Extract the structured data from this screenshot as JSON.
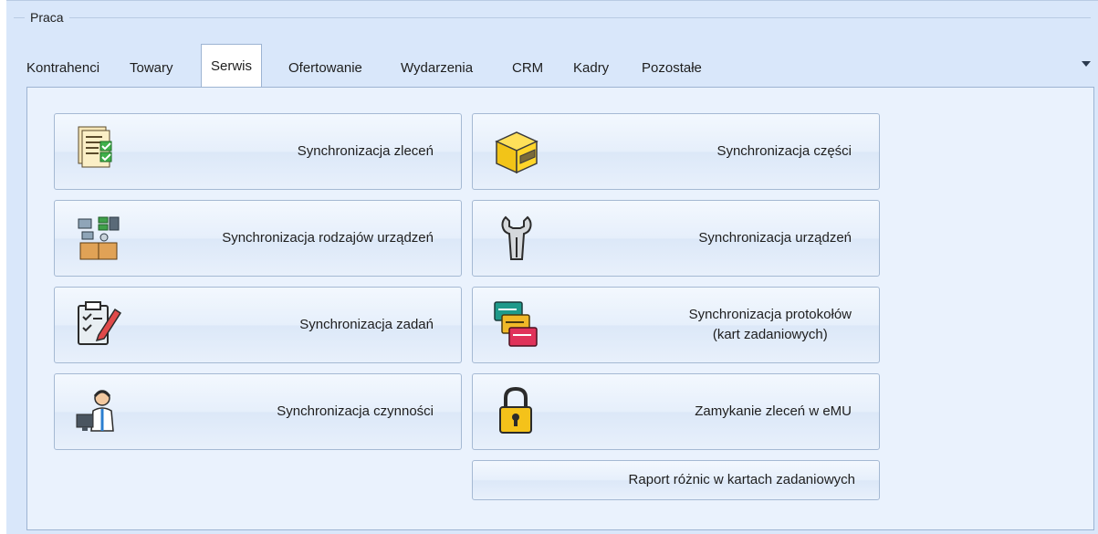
{
  "group": {
    "title": "Praca"
  },
  "tabs": [
    {
      "label": "Kontrahenci",
      "active": false
    },
    {
      "label": "Towary",
      "active": false
    },
    {
      "label": "Serwis",
      "active": true
    },
    {
      "label": "Ofertowanie",
      "active": false
    },
    {
      "label": "Wydarzenia",
      "active": false
    },
    {
      "label": "CRM",
      "active": false
    },
    {
      "label": "Kadry",
      "active": false
    },
    {
      "label": "Pozostałe",
      "active": false
    }
  ],
  "buttons": {
    "sync_orders": {
      "label": "Synchronizacja zleceń",
      "icon": "document-checklist-icon"
    },
    "sync_parts": {
      "label": "Synchronizacja części",
      "icon": "box-icon"
    },
    "sync_device_types": {
      "label": "Synchronizacja rodzajów urządzeń",
      "icon": "devices-box-icon"
    },
    "sync_devices": {
      "label": "Synchronizacja urządzeń",
      "icon": "wrench-icon"
    },
    "sync_tasks": {
      "label": "Synchronizacja zadań",
      "icon": "clipboard-pencil-icon"
    },
    "sync_protocols": {
      "label": "Synchronizacja protokołów\n(kart zadaniowych)",
      "icon": "cards-icon"
    },
    "sync_activities": {
      "label": "Synchronizacja czynności",
      "icon": "technician-icon"
    },
    "close_orders_emu": {
      "label": "Zamykanie zleceń w eMU",
      "icon": "padlock-icon"
    },
    "diff_report": {
      "label": "Raport różnic w kartach zadaniowych"
    }
  }
}
